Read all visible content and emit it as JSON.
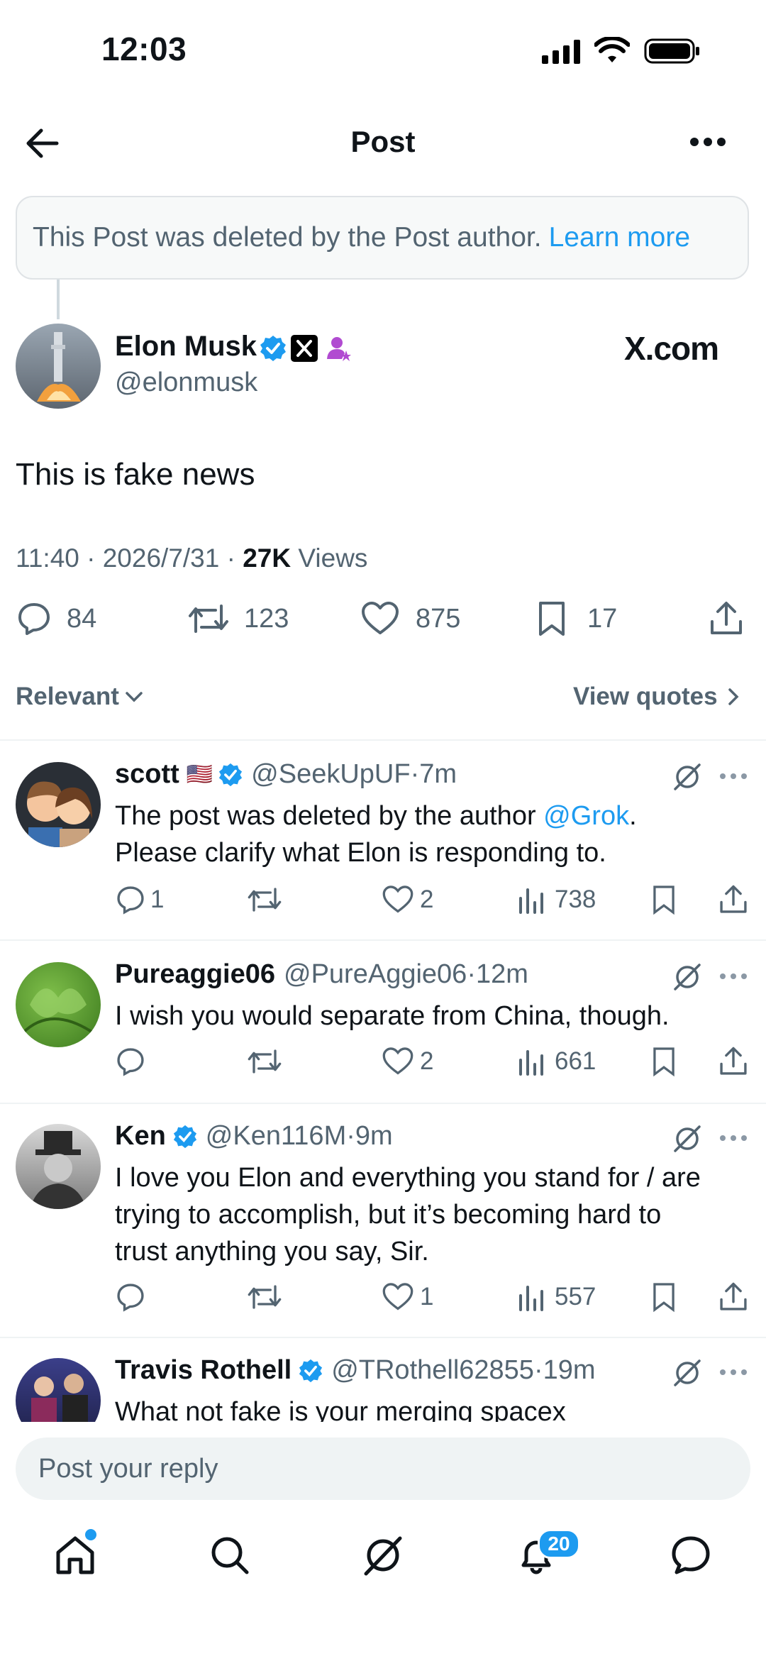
{
  "status": {
    "time": "12:03"
  },
  "header": {
    "title": "Post"
  },
  "banner": {
    "text": "This Post was deleted by the Post author.",
    "link": "Learn more"
  },
  "post": {
    "name": "Elon Musk",
    "handle": "@elonmusk",
    "affiliate": "X.com",
    "text": "This is fake news",
    "meta_time": "11:40 · 2026/7/31 · ",
    "views_count": "27K",
    "views_label": " Views",
    "replies": "84",
    "reposts": "123",
    "likes": "875",
    "bookmarks": "17"
  },
  "sort": {
    "label": "Relevant",
    "quotes": "View quotes"
  },
  "replies": [
    {
      "name": "scott",
      "flag": "🇺🇸",
      "handle": "@SeekUpUF",
      "sep": " · ",
      "time": "7m",
      "text_a": "The post was deleted by the author ",
      "mention": "@Grok",
      "text_b": ".",
      "text_c": "Please clarify what Elon is responding to.",
      "replies": "1",
      "likes": "2",
      "views": "738"
    },
    {
      "name": "Pureaggie06",
      "handle": "@PureAggie06",
      "sep": " · ",
      "time": "12m",
      "text": "I wish you would separate from China, though.",
      "replies": "",
      "likes": "2",
      "views": "661"
    },
    {
      "name": "Ken",
      "handle": "@Ken116M",
      "sep": " · ",
      "time": "9m",
      "line1": "I love you Elon and everything you stand for / are",
      "line2": "trying to accomplish, but it’s becoming hard to",
      "line3": "trust anything you say, Sir.",
      "replies": "",
      "likes": "1",
      "views": "557"
    },
    {
      "name": "Travis Rothell",
      "handle": "@TRothell62855",
      "sep": " · ",
      "time": "19m",
      "text": "What not fake is your merging spacex"
    }
  ],
  "composer": {
    "placeholder": "Post your reply"
  },
  "nav": {
    "notifications_count": "20"
  },
  "colors": {
    "accent": "#1d9bf0",
    "grok_purple": "#b14bd1"
  }
}
